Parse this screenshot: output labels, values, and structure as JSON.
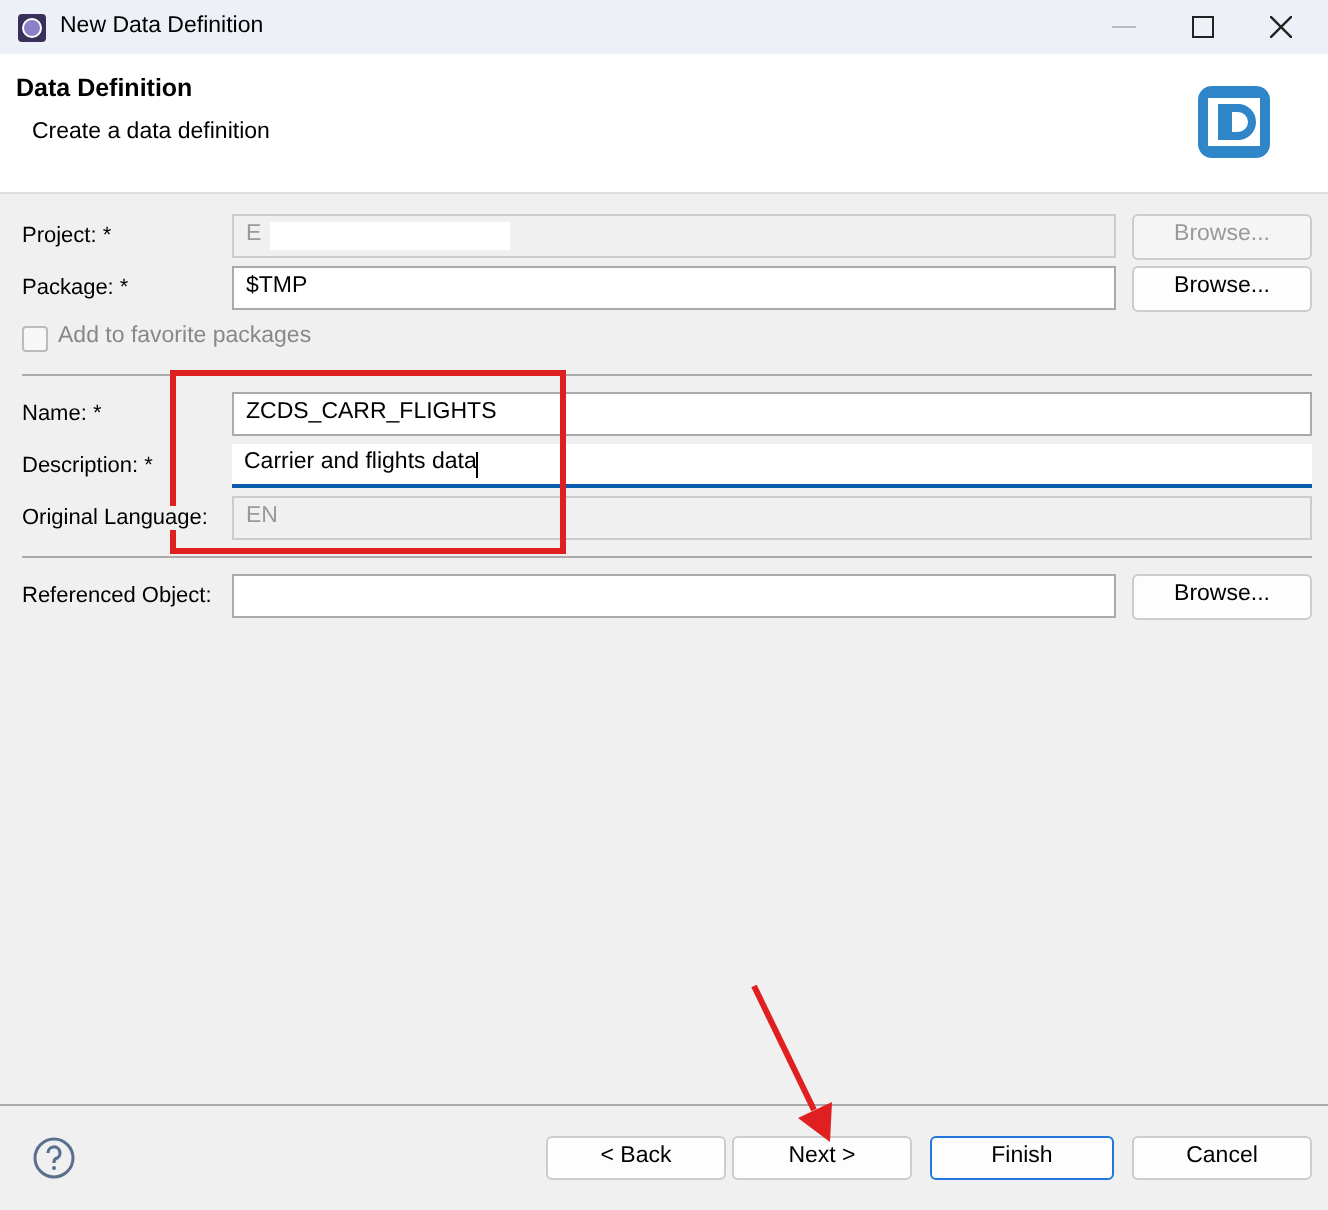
{
  "window": {
    "title": "New Data Definition"
  },
  "header": {
    "title": "Data Definition",
    "subtitle": "Create a data definition"
  },
  "fields": [
    {
      "kind": "field",
      "label": "Project: *",
      "value": "E",
      "disabled": true,
      "redacted": true,
      "focused": false,
      "button": {
        "label": "Browse...",
        "disabled": true
      }
    },
    {
      "kind": "field",
      "label": "Package: *",
      "value": "$TMP",
      "disabled": false,
      "focused": false,
      "button": {
        "label": "Browse...",
        "disabled": false
      }
    },
    {
      "kind": "checkbox",
      "label": "Add to favorite packages",
      "checked": false,
      "disabled": true
    },
    {
      "kind": "separator"
    },
    {
      "kind": "field",
      "label": "Name: *",
      "value": "ZCDS_CARR_FLIGHTS",
      "disabled": false,
      "focused": false
    },
    {
      "kind": "field",
      "label": "Description: *",
      "value": "Carrier and flights data",
      "disabled": false,
      "focused": true
    },
    {
      "kind": "field",
      "label": "Original Language:",
      "value": "EN",
      "disabled": true,
      "focused": false
    },
    {
      "kind": "separator"
    },
    {
      "kind": "field",
      "label": "Referenced Object:",
      "disabled": false,
      "focused": false,
      "button": {
        "label": "Browse...",
        "disabled": false
      }
    }
  ],
  "buttons": [
    {
      "label": "< Back",
      "default": false
    },
    {
      "label": "Next >",
      "default": false
    },
    {
      "label": "Finish",
      "default": true
    },
    {
      "label": "Cancel",
      "default": false
    }
  ],
  "annotations": [
    {
      "kind": "box",
      "color": "#e02020"
    },
    {
      "kind": "arrow",
      "color": "#e02020"
    }
  ]
}
